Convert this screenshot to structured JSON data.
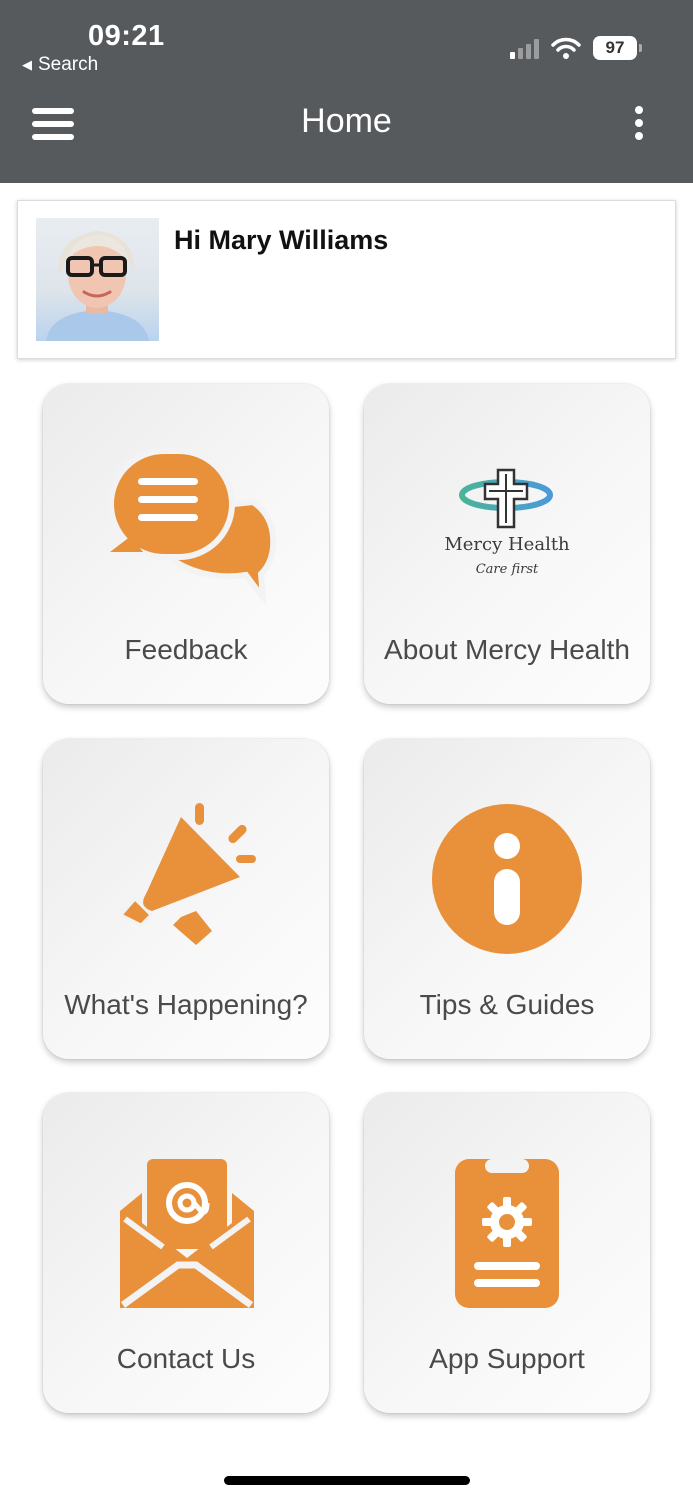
{
  "status_bar": {
    "time": "09:21",
    "back_label": "Search",
    "battery": "97"
  },
  "header": {
    "title": "Home"
  },
  "greeting": {
    "text": "Hi Mary Williams"
  },
  "tiles": [
    {
      "label": "Feedback",
      "icon": "chat-bubbles-icon"
    },
    {
      "label": "About Mercy Health",
      "icon": "mercy-health-logo",
      "logo_name": "Mercy Health",
      "logo_tagline": "Care first"
    },
    {
      "label": "What's Happening?",
      "icon": "megaphone-icon"
    },
    {
      "label": "Tips & Guides",
      "icon": "info-icon"
    },
    {
      "label": "Contact Us",
      "icon": "email-icon"
    },
    {
      "label": "App Support",
      "icon": "phone-settings-icon"
    }
  ],
  "colors": {
    "accent": "#e8913a",
    "header_bg": "#575a5d",
    "tile_text": "#4a4a4a"
  }
}
